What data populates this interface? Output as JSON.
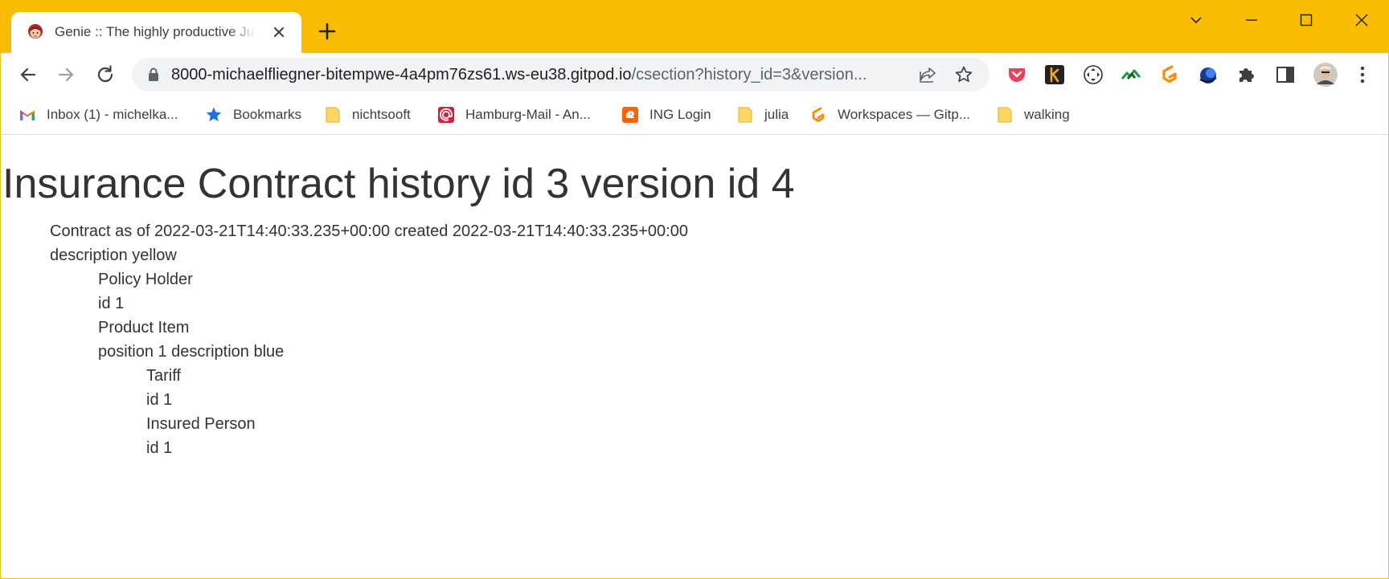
{
  "browser": {
    "tab": {
      "title": "Genie :: The highly productive Julia web framework"
    },
    "address_bar": {
      "url_host": "8000-michaelfliegner-bitempwe-4a4pm76zs61.ws-eu38.gitpod.io",
      "url_path": "/csection?history_id=3&version..."
    },
    "bookmarks": [
      {
        "label": "Inbox (1) - michelka...",
        "icon": "gmail-icon"
      },
      {
        "label": "Bookmarks",
        "icon": "star-icon"
      },
      {
        "label": "nichtsooft",
        "icon": "folder-icon"
      },
      {
        "label": "Hamburg-Mail - An...",
        "icon": "mail-at-icon"
      },
      {
        "label": "ING Login",
        "icon": "ing-lion-icon"
      },
      {
        "label": "julia",
        "icon": "folder-icon"
      },
      {
        "label": "Workspaces — Gitp...",
        "icon": "gitpod-icon"
      },
      {
        "label": "walking",
        "icon": "folder-icon"
      }
    ],
    "colors": {
      "frame": "#fbbc04",
      "omnibox": "#f1f3f4"
    }
  },
  "page": {
    "title": "Insurance Contract history id 3 version id 4",
    "lines": [
      "Contract as of 2022-03-21T14:40:33.235+00:00 created 2022-03-21T14:40:33.235+00:00",
      "description yellow",
      "Policy Holder",
      "id 1",
      "Product Item",
      "position 1 description blue",
      "Tariff",
      "id 1",
      "Insured Person",
      "id 1"
    ]
  }
}
